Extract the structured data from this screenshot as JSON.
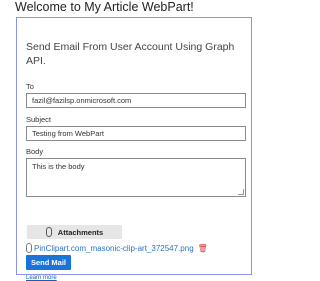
{
  "page": {
    "title": "Welcome to My Article WebPart!"
  },
  "webpart": {
    "heading": "Send Email From User Account Using Graph API.",
    "to": {
      "label": "To",
      "value": "fazil@fazilsp.onmicrosoft.com"
    },
    "subject": {
      "label": "Subject",
      "value": "Testing from WebPart"
    },
    "body": {
      "label": "Body",
      "value": "This is the body"
    },
    "attachments_button": "Attachments",
    "attachment_file": "PinClipart.com_masonic-clip-art_372547.png",
    "send_button": "Send Mail",
    "learn_more": "Learn more"
  },
  "icons": [
    "paperclip-icon",
    "trash-icon"
  ],
  "colors": {
    "accent": "#1a73d8",
    "border": "#8a93f0",
    "delete": "#d23a3a"
  }
}
